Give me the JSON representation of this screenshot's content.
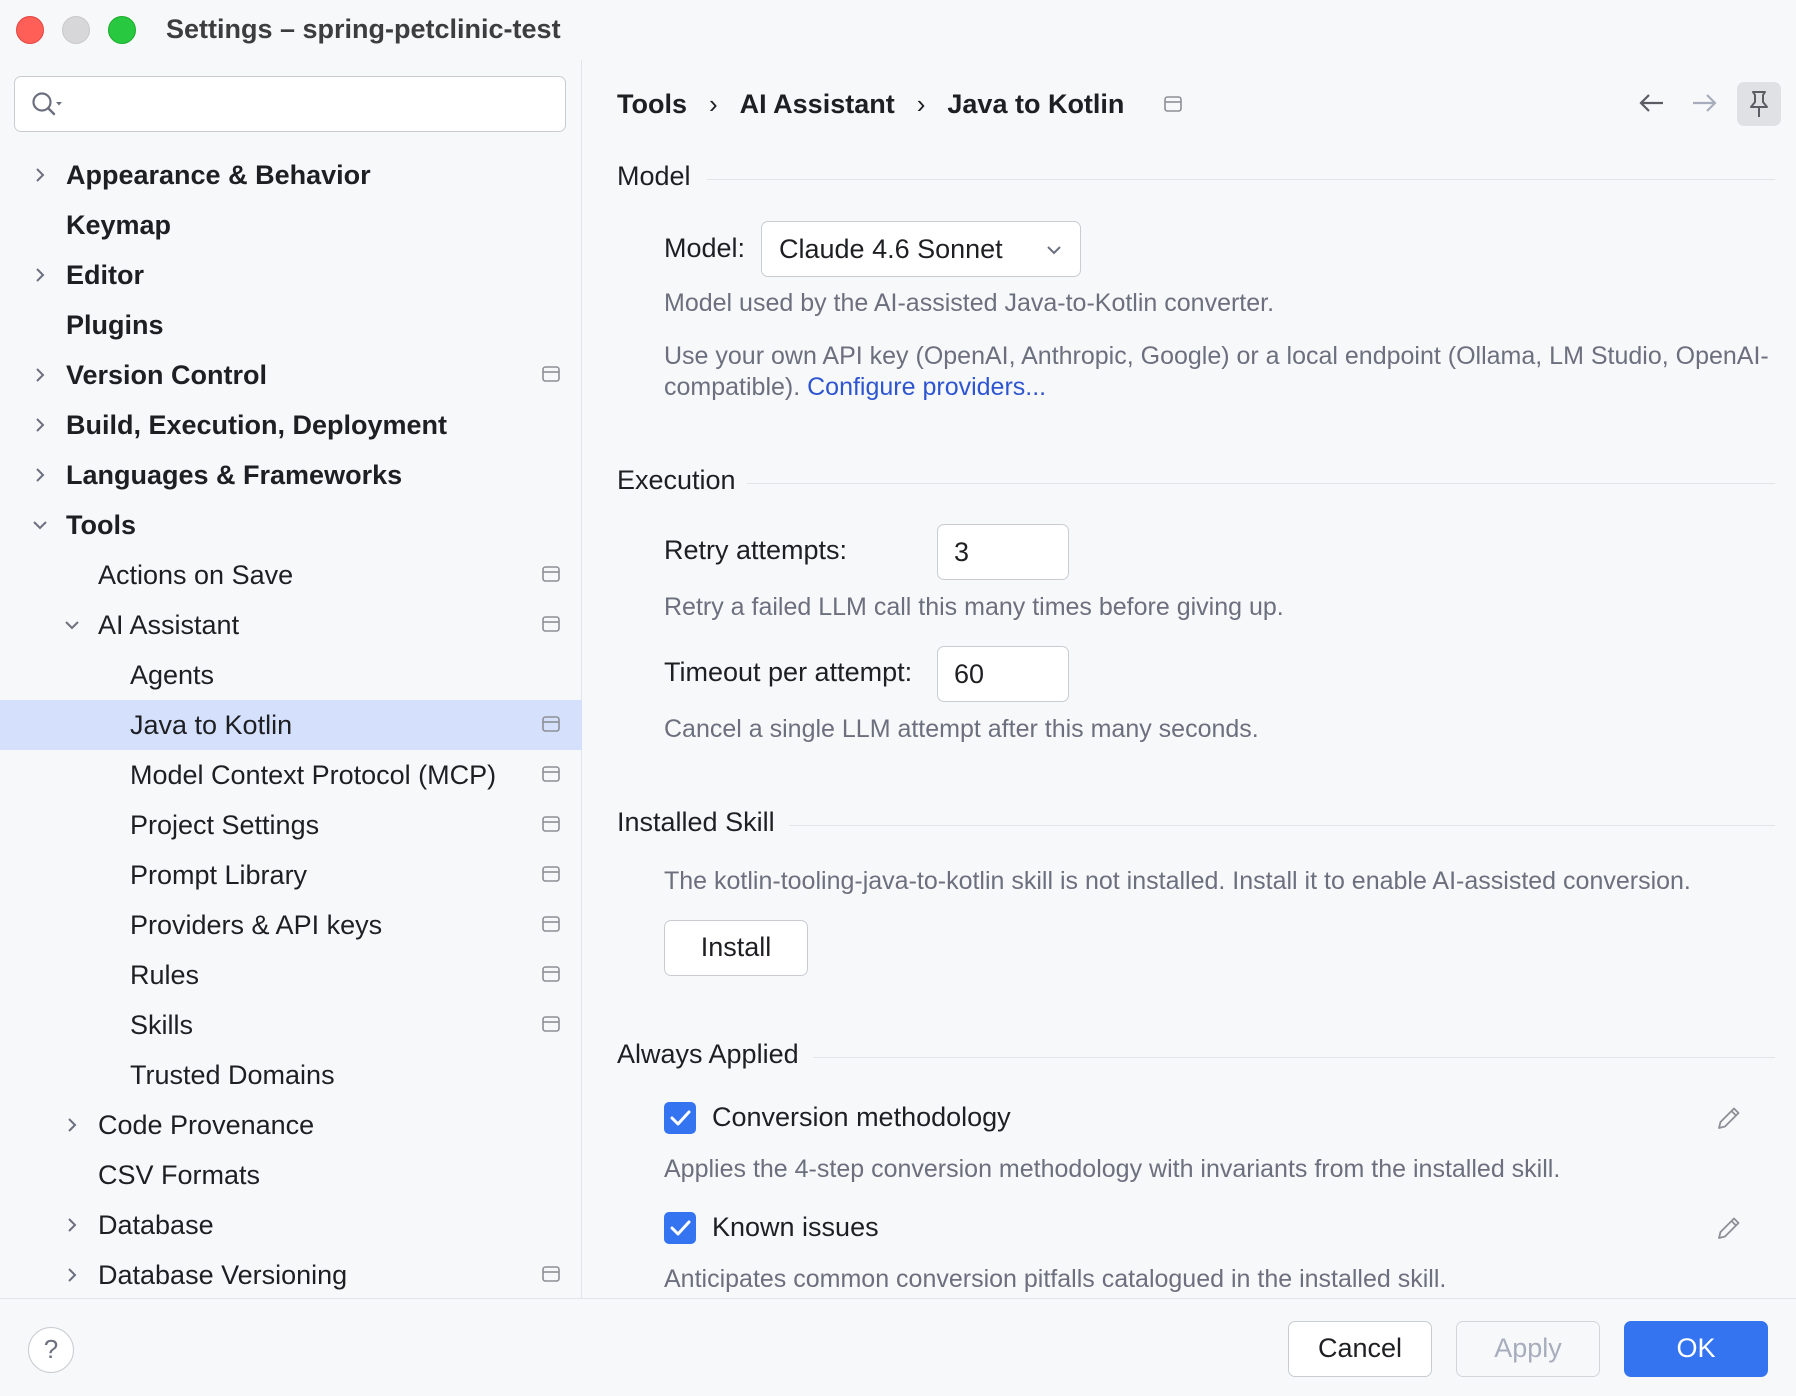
{
  "window": {
    "title": "Settings – spring-petclinic-test"
  },
  "search": {
    "placeholder": "",
    "icon": "search-icon"
  },
  "tree": [
    {
      "id": "appearance",
      "label": "Appearance & Behavior",
      "bold": true,
      "level": 0,
      "chevron": "right",
      "project_icon": false
    },
    {
      "id": "keymap",
      "label": "Keymap",
      "bold": true,
      "level": 0,
      "chevron": "none",
      "project_icon": false
    },
    {
      "id": "editor",
      "label": "Editor",
      "bold": true,
      "level": 0,
      "chevron": "right",
      "project_icon": false
    },
    {
      "id": "plugins",
      "label": "Plugins",
      "bold": true,
      "level": 0,
      "chevron": "none",
      "project_icon": false
    },
    {
      "id": "version-control",
      "label": "Version Control",
      "bold": true,
      "level": 0,
      "chevron": "right",
      "project_icon": true
    },
    {
      "id": "build",
      "label": "Build, Execution, Deployment",
      "bold": true,
      "level": 0,
      "chevron": "right",
      "project_icon": false
    },
    {
      "id": "languages",
      "label": "Languages & Frameworks",
      "bold": true,
      "level": 0,
      "chevron": "right",
      "project_icon": false
    },
    {
      "id": "tools",
      "label": "Tools",
      "bold": true,
      "level": 0,
      "chevron": "down",
      "project_icon": false
    },
    {
      "id": "actions-on-save",
      "label": "Actions on Save",
      "bold": false,
      "level": 1,
      "chevron": "none",
      "project_icon": true
    },
    {
      "id": "ai-assistant",
      "label": "AI Assistant",
      "bold": false,
      "level": 1,
      "chevron": "down",
      "project_icon": true
    },
    {
      "id": "agents",
      "label": "Agents",
      "bold": false,
      "level": 2,
      "chevron": "none",
      "project_icon": false
    },
    {
      "id": "java-to-kotlin",
      "label": "Java to Kotlin",
      "bold": false,
      "level": 2,
      "chevron": "none",
      "project_icon": true,
      "selected": true
    },
    {
      "id": "mcp",
      "label": "Model Context Protocol (MCP)",
      "bold": false,
      "level": 2,
      "chevron": "none",
      "project_icon": true
    },
    {
      "id": "project-settings",
      "label": "Project Settings",
      "bold": false,
      "level": 2,
      "chevron": "none",
      "project_icon": true
    },
    {
      "id": "prompt-library",
      "label": "Prompt Library",
      "bold": false,
      "level": 2,
      "chevron": "none",
      "project_icon": true
    },
    {
      "id": "providers",
      "label": "Providers & API keys",
      "bold": false,
      "level": 2,
      "chevron": "none",
      "project_icon": true
    },
    {
      "id": "rules",
      "label": "Rules",
      "bold": false,
      "level": 2,
      "chevron": "none",
      "project_icon": true
    },
    {
      "id": "skills",
      "label": "Skills",
      "bold": false,
      "level": 2,
      "chevron": "none",
      "project_icon": true
    },
    {
      "id": "trusted-domains",
      "label": "Trusted Domains",
      "bold": false,
      "level": 2,
      "chevron": "none",
      "project_icon": false
    },
    {
      "id": "code-provenance",
      "label": "Code Provenance",
      "bold": false,
      "level": 1,
      "chevron": "right",
      "project_icon": false
    },
    {
      "id": "csv-formats",
      "label": "CSV Formats",
      "bold": false,
      "level": 1,
      "chevron": "none",
      "project_icon": false
    },
    {
      "id": "database",
      "label": "Database",
      "bold": false,
      "level": 1,
      "chevron": "right",
      "project_icon": false
    },
    {
      "id": "database-versioning",
      "label": "Database Versioning",
      "bold": false,
      "level": 1,
      "chevron": "right",
      "project_icon": true
    }
  ],
  "breadcrumb": {
    "items": [
      "Tools",
      "AI Assistant",
      "Java to Kotlin"
    ],
    "separator": "›"
  },
  "sections": {
    "model": {
      "title": "Model",
      "label": "Model:",
      "value": "Claude 4.6 Sonnet",
      "hint": "Model used by the AI-assisted Java-to-Kotlin converter.",
      "hint2": "Use your own API key (OpenAI, Anthropic, Google) or a local endpoint (Ollama, LM Studio, OpenAI-compatible).",
      "link": "Configure providers..."
    },
    "execution": {
      "title": "Execution",
      "retry_label": "Retry attempts:",
      "retry_value": "3",
      "retry_hint": "Retry a failed LLM call this many times before giving up.",
      "timeout_label": "Timeout per attempt:",
      "timeout_value": "60",
      "timeout_hint": "Cancel a single LLM attempt after this many seconds."
    },
    "installed_skill": {
      "title": "Installed Skill",
      "hint": "The kotlin-tooling-java-to-kotlin skill is not installed. Install it to enable AI-assisted conversion.",
      "button": "Install"
    },
    "always_applied": {
      "title": "Always Applied",
      "items": [
        {
          "label": "Conversion methodology",
          "checked": true,
          "hint": "Applies the 4-step conversion methodology with invariants from the installed skill."
        },
        {
          "label": "Known issues",
          "checked": true,
          "hint": "Anticipates common conversion pitfalls catalogued in the installed skill."
        }
      ]
    }
  },
  "footer": {
    "help": "?",
    "cancel": "Cancel",
    "apply": "Apply",
    "ok": "OK"
  },
  "colors": {
    "accent": "#3574f0",
    "selection": "#d5e1fc",
    "link": "#2e55d0",
    "hint": "#6c707e"
  }
}
